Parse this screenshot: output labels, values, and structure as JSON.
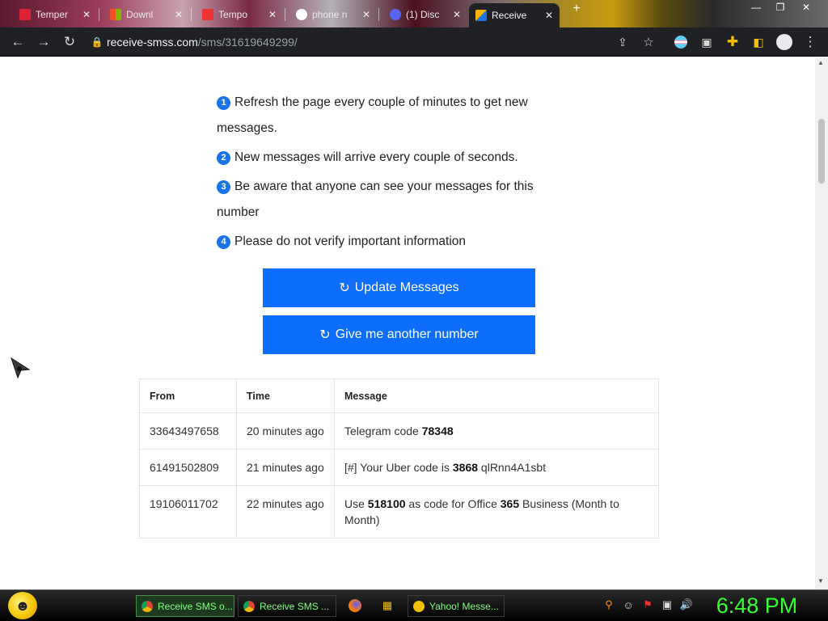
{
  "browser": {
    "tabs": [
      {
        "title": "Temper",
        "close": "✕"
      },
      {
        "title": "Downl",
        "close": "✕"
      },
      {
        "title": "Tempo",
        "close": "✕"
      },
      {
        "title": "phone n",
        "close": "✕"
      },
      {
        "title": "(1) Disc",
        "close": "✕"
      },
      {
        "title": "Receive",
        "close": "✕"
      }
    ],
    "url_host": "receive-smss.com",
    "url_path": "/sms/31619649299/"
  },
  "instructions": [
    {
      "num": "1",
      "text": "Refresh the page every couple of minutes to get new messages."
    },
    {
      "num": "2",
      "text": "New messages will arrive every couple of seconds."
    },
    {
      "num": "3",
      "text": "Be aware that anyone can see your messages for this number"
    },
    {
      "num": "4",
      "text": "Please do not verify important information"
    }
  ],
  "buttons": {
    "update": "Update Messages",
    "another": "Give me another number",
    "refresh_glyph": "↻"
  },
  "table": {
    "headers": {
      "from": "From",
      "time": "Time",
      "message": "Message"
    },
    "rows": [
      {
        "from": "33643497658",
        "time": "20 minutes ago",
        "msg": [
          {
            "t": "Telegram code "
          },
          {
            "b": "78348"
          }
        ]
      },
      {
        "from": "61491502809",
        "time": "21 minutes ago",
        "msg": [
          {
            "t": "[#] Your Uber code is "
          },
          {
            "b": "3868"
          },
          {
            "t": " qlRnn4A1sbt"
          }
        ]
      },
      {
        "from": "19106011702",
        "time": "22 minutes ago",
        "msg": [
          {
            "t": "Use "
          },
          {
            "b": "518100"
          },
          {
            "t": " as code for Office "
          },
          {
            "b": "365"
          },
          {
            "t": " Business (Month to Month)"
          }
        ]
      }
    ]
  },
  "taskbar": {
    "tasks": [
      {
        "label": "Receive SMS o...",
        "active": true
      },
      {
        "label": "Receive SMS ...",
        "active": false
      },
      {
        "label": "Yahoo! Messe...",
        "active": false
      }
    ],
    "clock": "6:48 PM"
  },
  "colors": {
    "accent": "#0d6efd",
    "badge": "#1a73e8",
    "clock": "#33ff33"
  }
}
